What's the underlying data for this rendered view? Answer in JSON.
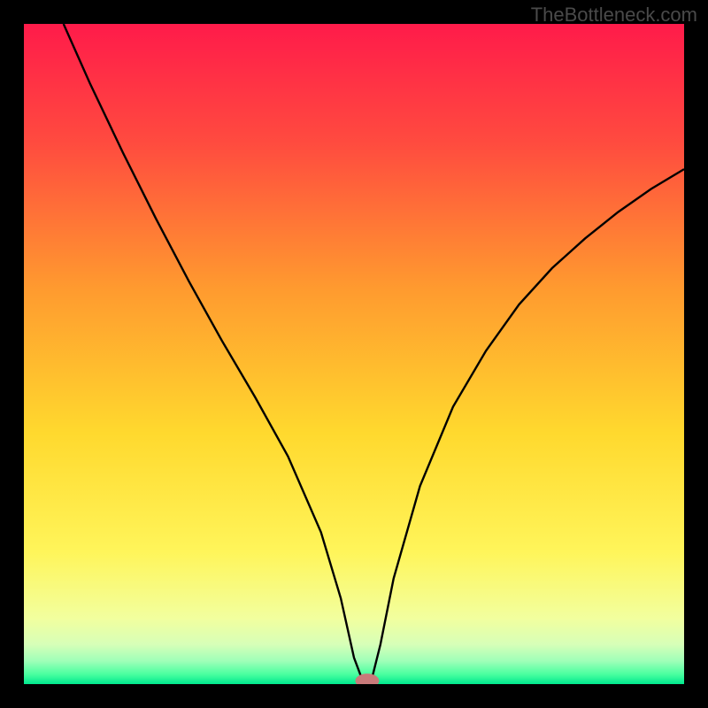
{
  "watermark": "TheBottleneck.com",
  "chart_data": {
    "type": "line",
    "title": "",
    "xlabel": "",
    "ylabel": "",
    "xlim": [
      0,
      100
    ],
    "ylim": [
      0,
      100
    ],
    "grid": false,
    "legend": false,
    "background_gradient": {
      "stops": [
        {
          "offset": 0.0,
          "color": "#ff1b4a"
        },
        {
          "offset": 0.18,
          "color": "#ff4b3f"
        },
        {
          "offset": 0.4,
          "color": "#ff9a2f"
        },
        {
          "offset": 0.62,
          "color": "#ffd92e"
        },
        {
          "offset": 0.8,
          "color": "#fff55a"
        },
        {
          "offset": 0.9,
          "color": "#f2ff9e"
        },
        {
          "offset": 0.94,
          "color": "#d7ffb8"
        },
        {
          "offset": 0.965,
          "color": "#9fffb8"
        },
        {
          "offset": 0.985,
          "color": "#4affa0"
        },
        {
          "offset": 1.0,
          "color": "#00e88e"
        }
      ]
    },
    "series": [
      {
        "name": "bottleneck-curve",
        "x": [
          6,
          10,
          15,
          20,
          25,
          30,
          35,
          40,
          45,
          48,
          50,
          51.5,
          52.5,
          54,
          56,
          60,
          65,
          70,
          75,
          80,
          85,
          90,
          95,
          100
        ],
        "y": [
          100,
          91,
          80.5,
          70.5,
          61,
          52,
          43.5,
          34.5,
          23,
          13,
          4,
          0,
          0,
          6,
          16,
          30,
          42,
          50.5,
          57.5,
          63,
          67.5,
          71.5,
          75,
          78
        ]
      }
    ],
    "marker": {
      "x": 52,
      "y": 0.5,
      "rx": 1.8,
      "ry": 1.1,
      "color": "#c97a7a"
    }
  }
}
